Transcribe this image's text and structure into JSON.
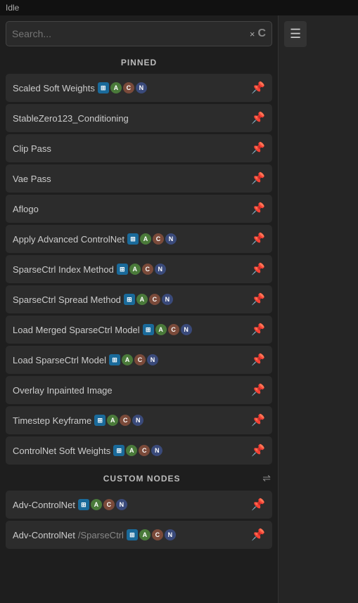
{
  "titleBar": {
    "label": "Idle"
  },
  "search": {
    "placeholder": "Search...",
    "clearLabel": "×",
    "loaderLabel": "C"
  },
  "pinnedSection": {
    "label": "PINNED"
  },
  "customNodesSection": {
    "label": "CUSTOM NODES"
  },
  "pinnedItems": [
    {
      "id": "scaled-soft-weights",
      "label": "Scaled Soft Weights",
      "badges": [
        "img",
        "A",
        "C",
        "N"
      ],
      "pinned": true
    },
    {
      "id": "stable-zero-conditioning",
      "label": "StableZero123_Conditioning",
      "badges": [],
      "pinned": true
    },
    {
      "id": "clip-pass",
      "label": "Clip Pass",
      "badges": [],
      "pinned": true
    },
    {
      "id": "vae-pass",
      "label": "Vae Pass",
      "badges": [],
      "pinned": true
    },
    {
      "id": "aflogo",
      "label": "Aflogo",
      "badges": [],
      "pinned": true
    },
    {
      "id": "apply-advanced-controlnet",
      "label": "Apply Advanced ControlNet",
      "badges": [
        "img",
        "A",
        "C",
        "N"
      ],
      "pinned": true
    },
    {
      "id": "sparsectrl-index-method",
      "label": "SparseCtrl Index Method",
      "badges": [
        "img",
        "A",
        "C",
        "N"
      ],
      "pinned": true
    },
    {
      "id": "sparsectrl-spread-method",
      "label": "SparseCtrl Spread Method",
      "badges": [
        "img",
        "A",
        "C",
        "N"
      ],
      "pinned": true
    },
    {
      "id": "load-merged-sparsectrl-model",
      "label": "Load Merged SparseCtrl Model",
      "badges": [
        "img",
        "A",
        "C",
        "N"
      ],
      "pinned": true
    },
    {
      "id": "load-sparsectrl-model",
      "label": "Load SparseCtrl Model",
      "badges": [
        "img",
        "A",
        "C",
        "N"
      ],
      "pinned": true
    },
    {
      "id": "overlay-inpainted-image",
      "label": "Overlay Inpainted Image",
      "badges": [],
      "pinned": true
    },
    {
      "id": "timestep-keyframe",
      "label": "Timestep Keyframe",
      "badges": [
        "img",
        "A",
        "C",
        "N"
      ],
      "pinned": true
    },
    {
      "id": "controlnet-soft-weights",
      "label": "ControlNet Soft Weights",
      "badges": [
        "img",
        "A",
        "C",
        "N"
      ],
      "pinned": true
    }
  ],
  "customNodes": [
    {
      "id": "adv-controlnet-1",
      "label": "Adv-ControlNet",
      "badges": [
        "img",
        "A",
        "C",
        "N"
      ],
      "pinned": false
    },
    {
      "id": "adv-controlnet-sparsectrl",
      "label": "Adv-ControlNet",
      "badges": [
        "img",
        "A",
        "C",
        "N"
      ],
      "suffix": "/SparseCtrl",
      "pinned": false
    }
  ],
  "menuButton": {
    "label": "☰"
  },
  "icons": {
    "pin": "📌",
    "settings": "⇌"
  }
}
